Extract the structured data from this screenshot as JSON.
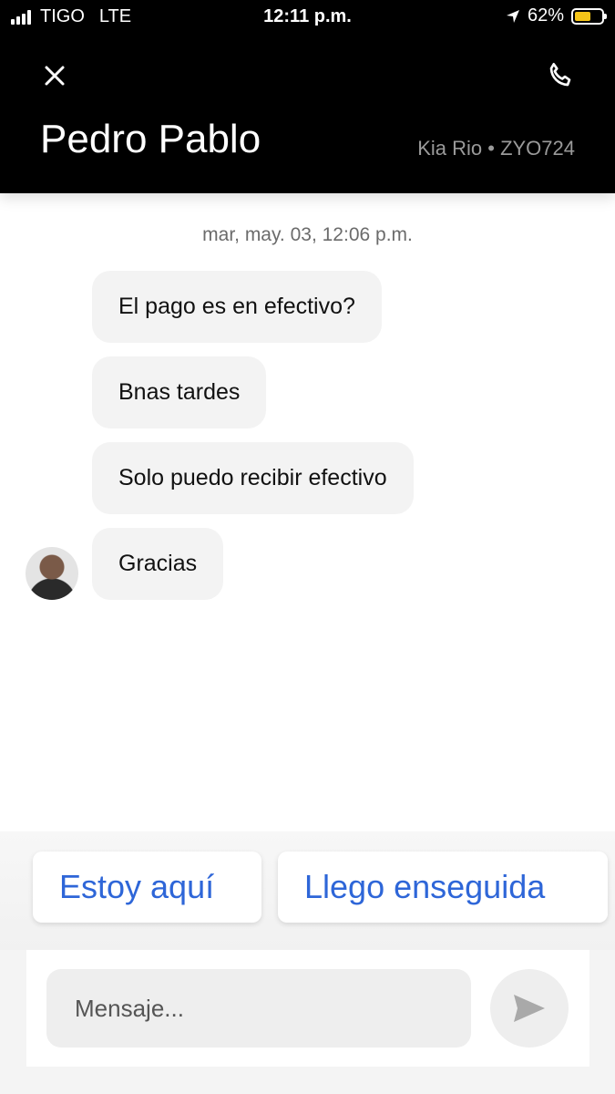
{
  "status_bar": {
    "carrier": "TIGO",
    "network": "LTE",
    "time": "12:11 p.m.",
    "battery_percent": "62%",
    "battery_level": 0.62,
    "battery_color": "#f5c518"
  },
  "header": {
    "driver_name": "Pedro Pablo",
    "vehicle": "Kia Rio • ZYO724",
    "close_icon": "close-icon",
    "call_icon": "phone-icon"
  },
  "chat": {
    "timestamp": "mar, may. 03, 12:06 p.m.",
    "messages": [
      "El pago es en efectivo?",
      "Bnas tardes",
      "Solo puedo recibir efectivo",
      "Gracias"
    ]
  },
  "quick_replies": [
    "Estoy aquí",
    "Llego enseguida"
  ],
  "composer": {
    "placeholder": "Mensaje...",
    "value": "",
    "send_icon": "send-icon"
  },
  "colors": {
    "accent": "#2e66d8",
    "header_bg": "#000000",
    "bubble_bg": "#f3f3f3"
  }
}
